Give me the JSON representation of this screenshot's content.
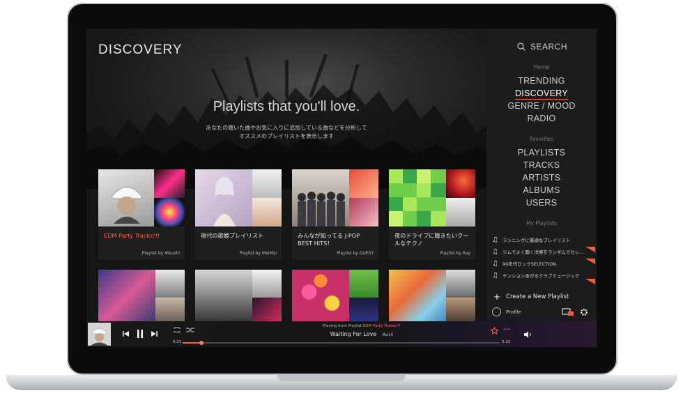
{
  "page": {
    "title": "DISCOVERY",
    "hero_title": "Playlists that you'll love.",
    "hero_sub_line1": "あなたの聴いた曲やお気に入りに追加している曲などを分析して",
    "hero_sub_line2": "オススメのプレイリストを表示します"
  },
  "cards": [
    {
      "title": "EDM Party Tracks!!!",
      "by": "Playlist by Atsushi",
      "active": true
    },
    {
      "title": "現代の歌姫プレイリスト",
      "by": "Playlist by MaiMai"
    },
    {
      "title": "みんなが知ってる J-POP BEST HITS！",
      "by": "Playlist by GUEST"
    },
    {
      "title": "夜のドライブに聴きたいクールなテクノ",
      "by": "Playlist by Ray"
    }
  ],
  "sidebar": {
    "search_label": "SEARCH",
    "home_label": "Home",
    "nav": [
      {
        "label": "TRENDING"
      },
      {
        "label": "DISCOVERY",
        "active": true
      },
      {
        "label": "GENRE / MOOD"
      },
      {
        "label": "RADIO"
      }
    ],
    "favorites_label": "Favorites",
    "favorites": [
      {
        "label": "PLAYLISTS"
      },
      {
        "label": "TRACKS"
      },
      {
        "label": "ARTISTS"
      },
      {
        "label": "ALBUMS"
      },
      {
        "label": "USERS"
      }
    ],
    "my_playlists_label": "My Playlists",
    "my_playlists": [
      {
        "label": "ランニングに最適なプレイリスト"
      },
      {
        "label": "ジムでよく聴く洋楽をランダムでセレ…"
      },
      {
        "label": "90年代ロックSELECTION"
      },
      {
        "label": "テンションあがるクラブミュージック"
      }
    ],
    "create_label": "Create a New Playlist",
    "profile_label": "Profile"
  },
  "player": {
    "playing_from_prefix": "Playing from Playlist",
    "playing_from_name": "EDM Party Tracks!!!",
    "track": "Waiting For Love",
    "artist": "Avicii",
    "elapsed": "0:21",
    "duration": "5:32",
    "progress_fraction": 0.06
  },
  "colors": {
    "accent": "#ff5a3a"
  }
}
